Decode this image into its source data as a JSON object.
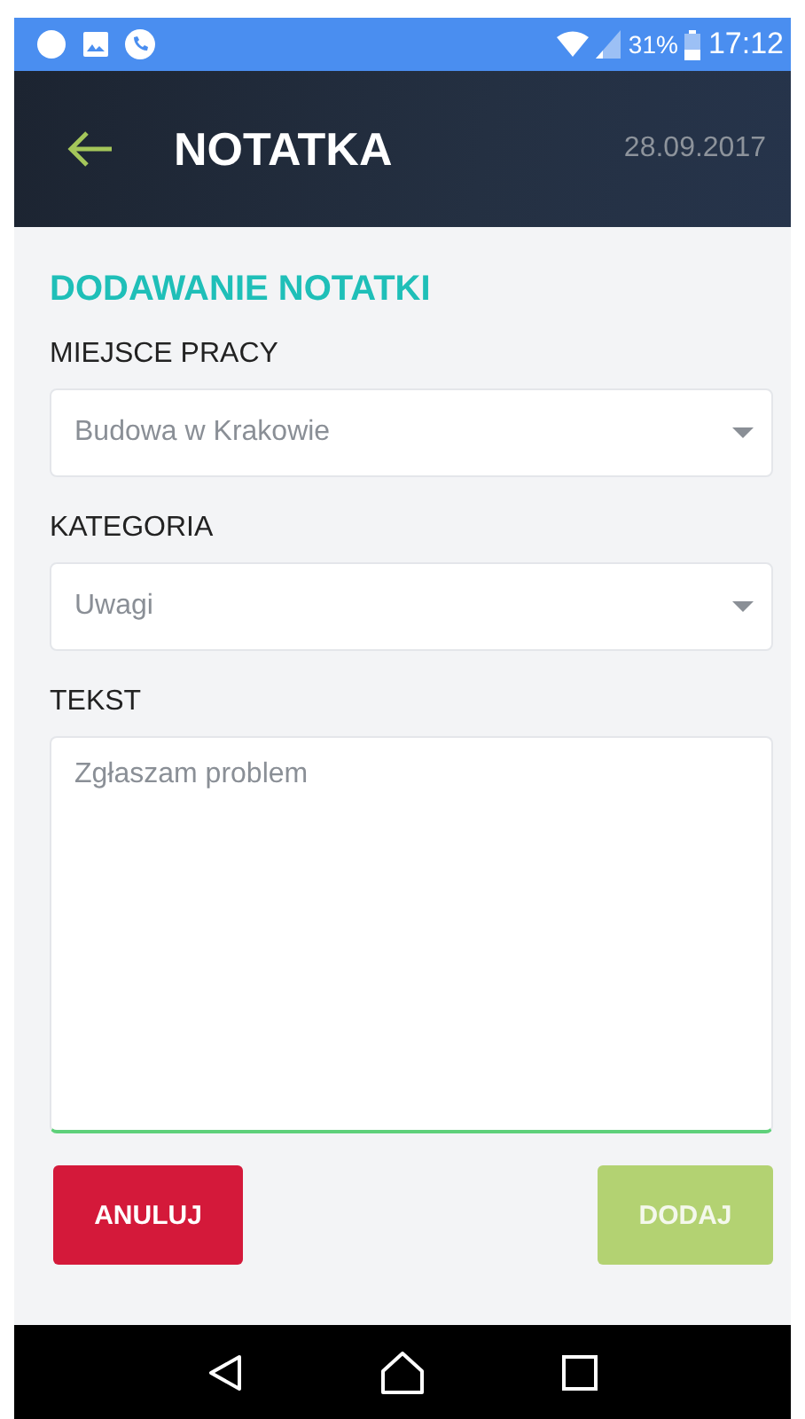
{
  "status_bar": {
    "battery": "31%",
    "time": "17:12"
  },
  "header": {
    "title": "NOTATKA",
    "date": "28.09.2017"
  },
  "form": {
    "heading": "DODAWANIE NOTATKI",
    "fields": [
      {
        "kind": "select",
        "label": "MIEJSCE PRACY",
        "value": "Budowa w Krakowie"
      },
      {
        "kind": "select",
        "label": "KATEGORIA",
        "value": "Uwagi"
      },
      {
        "kind": "textarea",
        "label": "TEKST",
        "value": "Zgłaszam problem",
        "focused": true
      }
    ]
  },
  "buttons": [
    {
      "kind": "cancel",
      "label": "ANULUJ"
    },
    {
      "kind": "confirm",
      "label": "DODAJ"
    }
  ]
}
